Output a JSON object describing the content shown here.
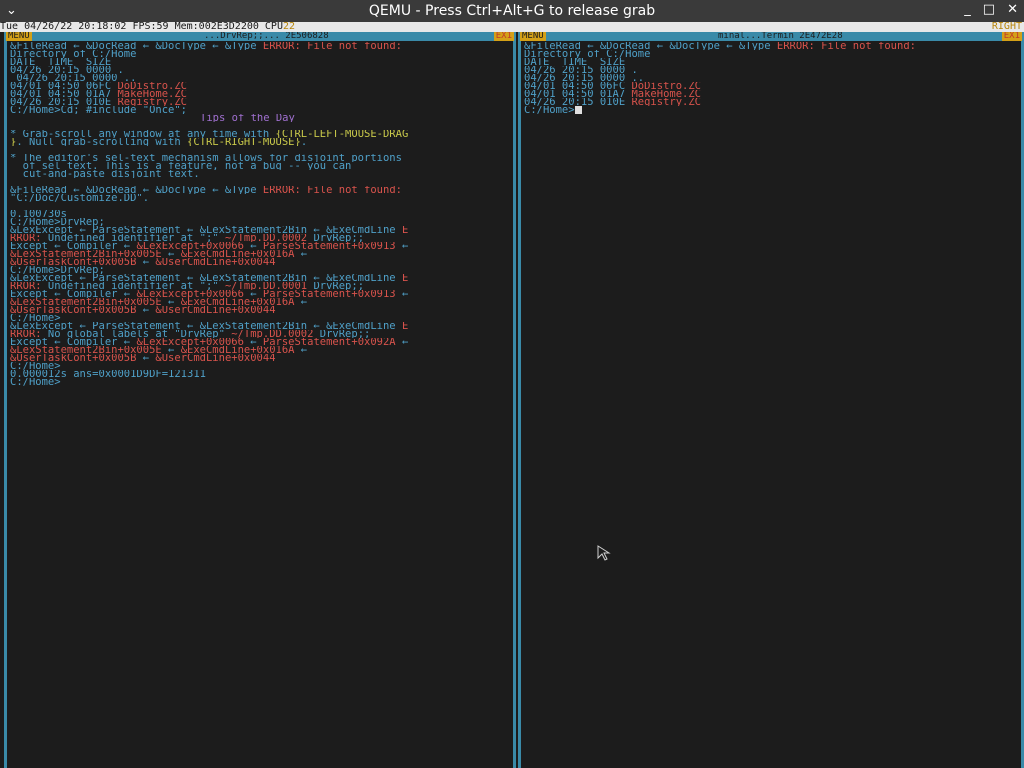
{
  "window": {
    "title": "QEMU - Press Ctrl+Alt+G to release grab"
  },
  "status": {
    "text": "Tue 04/26/22 20:18:02 FPS:59 Mem:002E3D2200 CPU",
    "cpu": "22",
    "right": "RIGHT"
  },
  "left_window": {
    "menu": "MENU",
    "title": "...DrvRep;;... 2E506828",
    "close": "EX1",
    "lines": [
      {
        "t": "&FileRead ← &DocRead ← &DocType ← &Type ",
        "e": "ERROR:",
        "r": " File not found:"
      },
      {
        "t": "Directory of C:/Home"
      },
      {
        "t": "DATE_ TIME_ SIZE"
      },
      {
        "t": "04/26 20:15 0000 ."
      },
      {
        "t": " 04/26 20:15 0000 .."
      },
      {
        "t": "04/01 04:50 06FC ",
        "l": "DoDistro.ZC"
      },
      {
        "t": "04/01 04:50 01A7 ",
        "l": "MakeHome.ZC"
      },
      {
        "t": "04/26 20:15 010E ",
        "l": "Registry.ZC"
      },
      {
        "t": "C:/Home>Cd; #include \"Once\";"
      },
      {
        "tip": "Tips of the Day"
      },
      {
        "t": ""
      },
      {
        "t": "* Grab-scroll any window at any time with ",
        "y": "{CTRL-LEFT-MOUSE-DRAG"
      },
      {
        "y": "}",
        "t2": ". Null grab-scrolling with ",
        "y2": "{CTRL-RIGHT-MOUSE}",
        "t3": "."
      },
      {
        "t": ""
      },
      {
        "t": "* The editor's sel-text mechanism allows for disjoint portions"
      },
      {
        "t": "  of sel text. This is a feature, not a bug -- you can"
      },
      {
        "t": "  cut-and-paste disjoint text."
      },
      {
        "t": ""
      },
      {
        "t": "&FileRead ← &DocRead ← &DocType ← &Type ",
        "e": "ERROR:",
        "r": " File not found:"
      },
      {
        "t": "\"C:/Doc/Customize.DD\"."
      },
      {
        "t": ""
      },
      {
        "t": "0.100730s"
      },
      {
        "t": "C:/Home>DrvRep;"
      },
      {
        "t": "&LexExcept ← ParseStatement ← &LexStatement2Bin ← &ExeCmdLine ",
        "e": "E"
      },
      {
        "e": "RROR:",
        "t": " Undefined identifier at \";\" ",
        "l": "~/Tmp.DD.0002",
        "t2": " DrvRep;;"
      },
      {
        "t": "Except ← Compiler ← ",
        "l": "&LexExcept+0x0066",
        "t2": " ← ",
        "l2": "ParseStatement+0x0913",
        "t3": " ←"
      },
      {
        "l": "&LexStatement2Bin+0x005E",
        "t": " ← ",
        "l2": "&ExeCmdLine+0x016A",
        "t2": " ←"
      },
      {
        "l": "&UserTaskCont+0x005B",
        "t": " ← ",
        "l2": "&UserCmdLine+0x0044"
      },
      {
        "t": "C:/Home>DrvRep;"
      },
      {
        "t": "&LexExcept ← ParseStatement ← &LexStatement2Bin ← &ExeCmdLine ",
        "e": "E"
      },
      {
        "e": "RROR:",
        "t": " Undefined identifier at \";\" ",
        "l": "~/Tmp.DD.0001",
        "t2": " DrvRep;;"
      },
      {
        "t": "Except ← Compiler ← ",
        "l": "&LexExcept+0x0066",
        "t2": " ← ",
        "l2": "ParseStatement+0x0913",
        "t3": " ←"
      },
      {
        "l": "&LexStatement2Bin+0x005E",
        "t": " ← ",
        "l2": "&ExeCmdLine+0x016A",
        "t2": " ←"
      },
      {
        "l": "&UserTaskCont+0x005B",
        "t": " ← ",
        "l2": "&UserCmdLine+0x0044"
      },
      {
        "t": "C:/Home>"
      },
      {
        "t": "&LexExcept ← ParseStatement ← &LexStatement2Bin ← &ExeCmdLine ",
        "e": "E"
      },
      {
        "e": "RROR:",
        "t": " No global labels at \"DrvRep\" ",
        "l": "~/Tmp.DD.0002",
        "t2": " DrvRep;;"
      },
      {
        "t": "Except ← Compiler ← ",
        "l": "&LexExcept+0x0066",
        "t2": " ← ",
        "l2": "ParseStatement+0x092A",
        "t3": " ←"
      },
      {
        "l": "&LexStatement2Bin+0x005E",
        "t": " ← ",
        "l2": "&ExeCmdLine+0x016A",
        "t2": " ←"
      },
      {
        "l": "&UserTaskCont+0x005B",
        "t": " ← ",
        "l2": "&UserCmdLine+0x0044"
      },
      {
        "t": "C:/Home>"
      },
      {
        "t": "0.000012s ans=0x0001D9DF=121311"
      },
      {
        "t": "C:/Home>"
      }
    ]
  },
  "right_window": {
    "menu": "MENU",
    "title": "minal...Termin 2E472E28",
    "close": "EX1",
    "lines": [
      {
        "t": "&FileRead ← &DocRead ← &DocType ← &Type ",
        "e": "ERROR:",
        "r": " File not found:"
      },
      {
        "t": "Directory of C:/Home"
      },
      {
        "t": "DATE_ TIME_ SIZE"
      },
      {
        "t": "04/26 20:15 0000 ."
      },
      {
        "t": "04/26 20:15 0000 .."
      },
      {
        "t": "04/01 04:50 06FC ",
        "l": "DoDistro.ZC"
      },
      {
        "t": "04/01 04:50 01A7 ",
        "l": "MakeHome.ZC"
      },
      {
        "t": "04/26 20:15 010E ",
        "l": "Registry.ZC"
      },
      {
        "t": "C:/Home>"
      }
    ]
  }
}
